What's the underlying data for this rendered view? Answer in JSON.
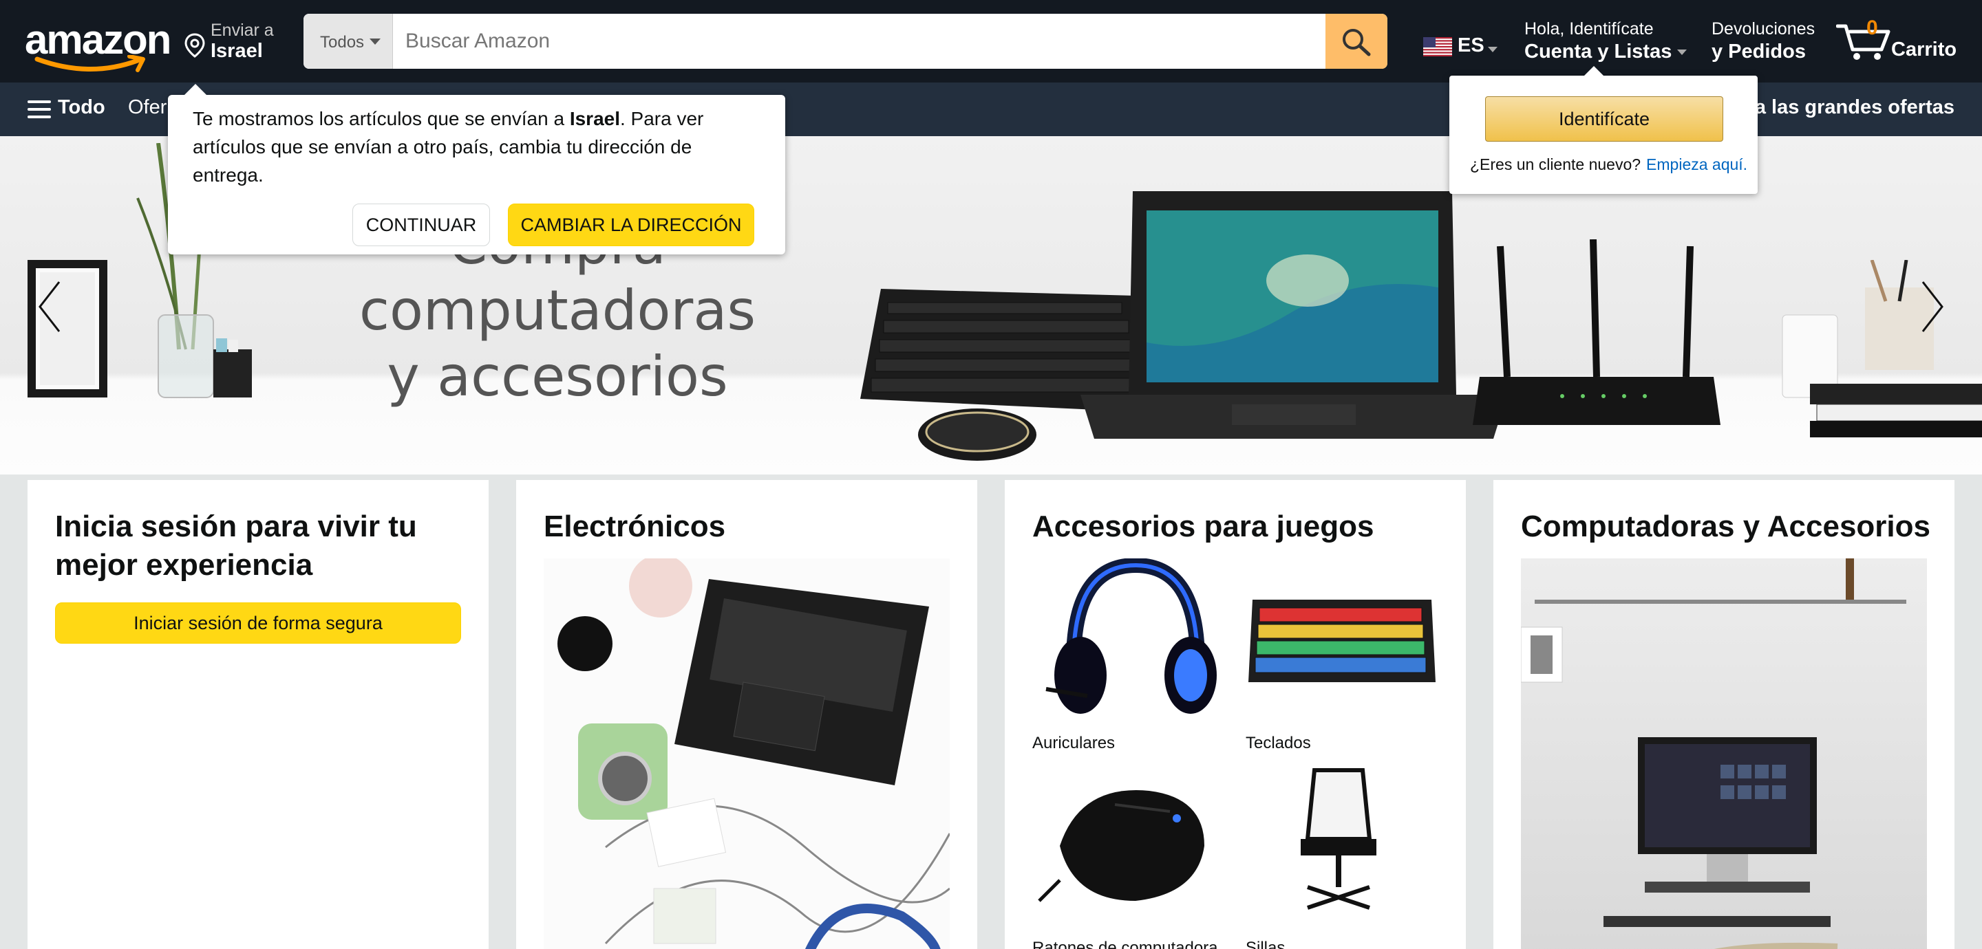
{
  "header": {
    "logo_text": "amazon",
    "deliver_line1": "Enviar a",
    "deliver_line2": "Israel",
    "search_category": "Todos",
    "search_placeholder": "Buscar Amazon",
    "language": "ES",
    "account_line1": "Hola, Identifícate",
    "account_line2": "Cuenta y Listas",
    "returns_line1": "Devoluciones",
    "returns_line2": "y Pedidos",
    "cart_count": "0",
    "cart_label": "Carrito"
  },
  "nav": {
    "all_label": "Todo",
    "partial_link": "Ofer",
    "promo_partial": "va las grandes ofertas"
  },
  "hero": {
    "line1": "Compra computadoras",
    "line2": "y accesorios"
  },
  "location_popover": {
    "msg_part1": "Te mostramos los artículos que se envían a ",
    "msg_country": "Israel",
    "msg_part2": ". Para ver artículos que se envían a otro país, cambia tu dirección de entrega.",
    "continue_label": "CONTINUAR",
    "change_label": "CAMBIAR LA DIRECCIÓN"
  },
  "account_popover": {
    "signin_label": "Identifícate",
    "new_customer_text": "¿Eres un cliente nuevo?",
    "start_here": "Empieza aquí."
  },
  "cards": {
    "signin": {
      "title": "Inicia sesión para vivir tu mejor experiencia",
      "button": "Iniciar sesión de forma segura"
    },
    "electronics": {
      "title": "Electrónicos"
    },
    "gaming": {
      "title": "Accesorios para juegos",
      "items": [
        {
          "label": "Auriculares"
        },
        {
          "label": "Teclados"
        },
        {
          "label": "Ratones de computadora"
        },
        {
          "label": "Sillas"
        }
      ]
    },
    "computers": {
      "title": "Computadoras y Accesorios"
    }
  },
  "colors": {
    "nav_dark": "#131921",
    "nav_secondary": "#232f3e",
    "search_button": "#febd69",
    "accent_yellow": "#ffd814",
    "link_blue": "#0066c0",
    "cart_count": "#f08804"
  },
  "icons": [
    "location-pin-icon",
    "search-icon",
    "us-flag-icon",
    "cart-icon",
    "hamburger-icon",
    "chevron-left-icon",
    "chevron-right-icon"
  ]
}
